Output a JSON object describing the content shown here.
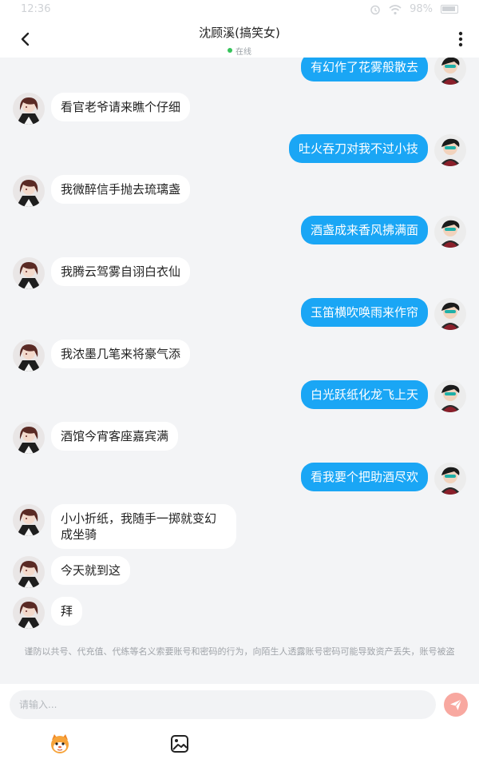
{
  "status_bar": {
    "time": "12:36",
    "battery": "98%"
  },
  "header": {
    "title": "沈顾溪(搞笑女)",
    "status": "在线"
  },
  "colors": {
    "sent_bubble": "#1aa6f5",
    "received_bubble": "#ffffff",
    "online_dot": "#36c35b",
    "send_button": "#f8a8a0"
  },
  "messages": [
    {
      "side": "right",
      "text": "有幻作了花雾般散去"
    },
    {
      "side": "left",
      "text": "看官老爷请来瞧个仔细"
    },
    {
      "side": "right",
      "text": "吐火吞刀对我不过小技"
    },
    {
      "side": "left",
      "text": "我微醉信手抛去琉璃盏"
    },
    {
      "side": "right",
      "text": "酒盏成来香风拂满面"
    },
    {
      "side": "left",
      "text": "我腾云驾雾自诩白衣仙"
    },
    {
      "side": "right",
      "text": "玉笛横吹唤雨来作帘"
    },
    {
      "side": "left",
      "text": "我浓墨几笔来将豪气添"
    },
    {
      "side": "right",
      "text": "白光跃纸化龙飞上天"
    },
    {
      "side": "left",
      "text": "酒馆今宵客座嘉宾满"
    },
    {
      "side": "right",
      "text": "看我要个把助酒尽欢"
    },
    {
      "side": "left",
      "text": "小小折纸，我随手一掷就变幻成坐骑"
    },
    {
      "side": "left",
      "text": "今天就到这"
    },
    {
      "side": "left",
      "text": "拜"
    }
  ],
  "notice": "谨防以共号、代充值、代练等名义索要账号和密码的行为，向陌生人透露账号密码可能导致资产丢失，账号被盗",
  "composer": {
    "placeholder": "请输入...",
    "tools": [
      "emoji-mascot-icon",
      "image-icon"
    ]
  },
  "icons": {
    "back": "chevron-left-icon",
    "more": "more-vertical-icon",
    "send": "paper-plane-icon"
  }
}
